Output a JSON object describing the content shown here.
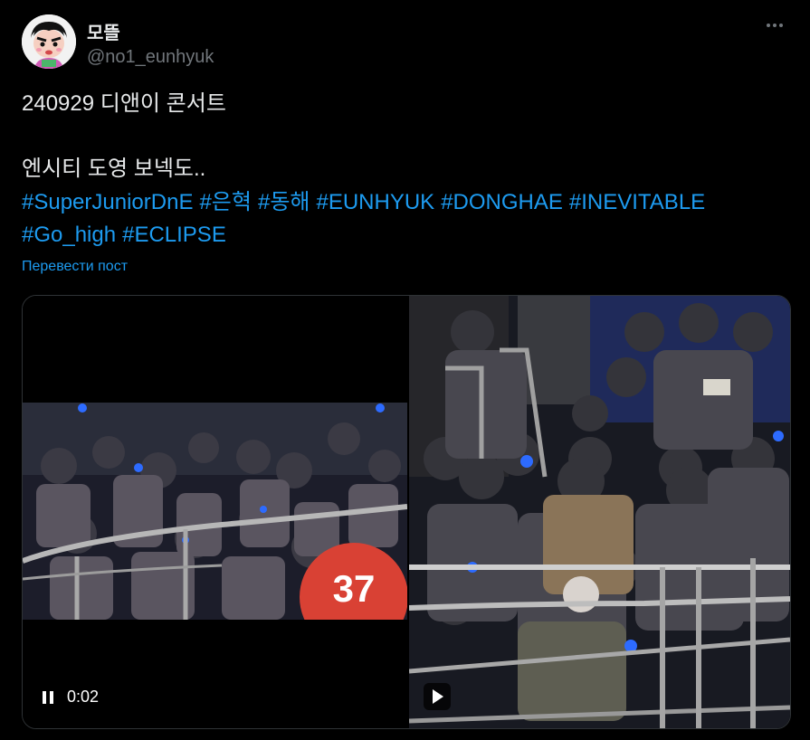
{
  "author": {
    "display_name": "모뜰",
    "handle": "@no1_eunhyuk"
  },
  "tweet": {
    "line1": "240929 디앤이 콘서트",
    "line2": "엔시티 도영 보넥도..",
    "hashtags_row1": [
      "#SuperJuniorDnE",
      "#은혁",
      "#동해",
      "#EUNHYUK",
      "#DONGHAE",
      "#INEVITABLE"
    ],
    "hashtags_row2": [
      "#Go_high",
      "#ECLIPSE"
    ],
    "translate_label": "Перевести пост"
  },
  "media": {
    "video_time": "0:02",
    "seat_number": "37"
  },
  "colors": {
    "link": "#1d9bf0",
    "text": "#e7e9ea",
    "muted": "#71767b",
    "lightstick": "#2d6bff"
  }
}
